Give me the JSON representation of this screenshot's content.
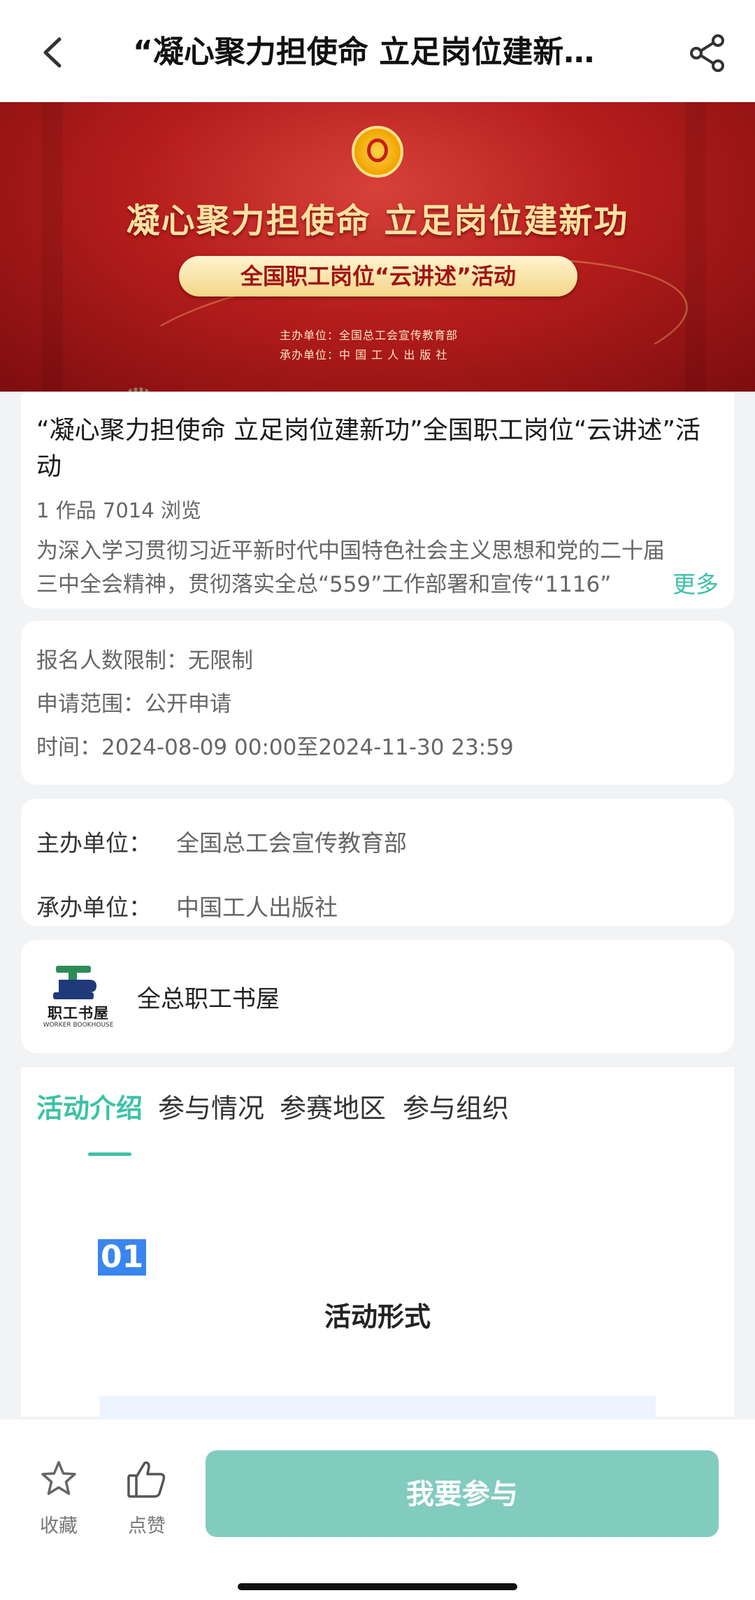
{
  "header": {
    "title": "“凝心聚力担使命 立足岗位建新功”全国职工岗位“云讲述”活动",
    "back_icon": "chevron-left-icon",
    "share_icon": "share-icon"
  },
  "banner": {
    "title": "凝心聚力担使命  立足岗位建新功",
    "subtitle": "全国职工岗位“云讲述”活动",
    "organizer": "主办单位：全国总工会宣传教育部",
    "undertaker": "承办单位：中 国 工 人 出 版 社"
  },
  "activity": {
    "title": "“凝心聚力担使命 立足岗位建新功”全国职工岗位“云讲述”活动",
    "stats": "1 作品 7014 浏览",
    "description": "为深入学习贯彻习近平新时代中国特色社会主义思想和党的二十届三中全会精神，贯彻落实全总“559”工作部署和宣传“1116”",
    "more_label": "更多"
  },
  "info": {
    "limit": "报名人数限制：无限制",
    "scope": "申请范围：公开申请",
    "time": "时间：2024-08-09 00:00至2024-11-30 23:59"
  },
  "organizers": {
    "host_label": "主办单位：",
    "host_value": "全国总工会宣传教育部",
    "undertaker_label": "承办单位：",
    "undertaker_value": "中国工人出版社"
  },
  "publisher": {
    "logo_cn": "职工书屋",
    "logo_en": "WORKER BOOKHOUSE",
    "name": "全总职工书屋"
  },
  "tabs": [
    {
      "label": "活动介绍",
      "active": true
    },
    {
      "label": "参与情况",
      "active": false
    },
    {
      "label": "参赛地区",
      "active": false
    },
    {
      "label": "参与组织",
      "active": false
    }
  ],
  "section": {
    "number": "01",
    "title": "活动形式"
  },
  "bottom": {
    "favorite_label": "收藏",
    "like_label": "点赞",
    "join_label": "我要参与"
  },
  "colors": {
    "accent": "#3ec1a6",
    "button": "#82cbbf",
    "banner_red": "#b51d1c",
    "banner_gold": "#ffe2a1"
  }
}
